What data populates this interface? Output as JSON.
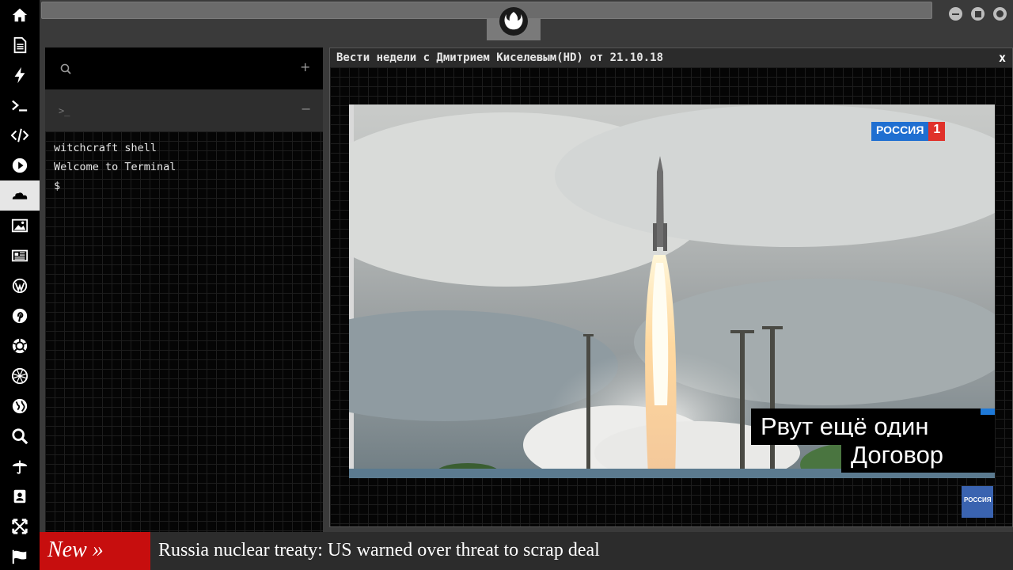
{
  "sidebar": {
    "items": [
      {
        "icon": "home-icon"
      },
      {
        "icon": "document-icon"
      },
      {
        "icon": "lightning-icon"
      },
      {
        "icon": "terminal-icon"
      },
      {
        "icon": "code-icon"
      },
      {
        "icon": "play-icon"
      },
      {
        "icon": "cloud-icon",
        "active": true
      },
      {
        "icon": "image-icon"
      },
      {
        "icon": "newspaper-icon"
      },
      {
        "icon": "wordpress-icon"
      },
      {
        "icon": "pinterest-icon"
      },
      {
        "icon": "aperture-icon"
      },
      {
        "icon": "globe-wire-icon"
      },
      {
        "icon": "globe-icon"
      },
      {
        "icon": "search-icon"
      },
      {
        "icon": "umbrella-icon"
      },
      {
        "icon": "contact-icon"
      },
      {
        "icon": "expand-icon"
      },
      {
        "icon": "flag-icon"
      }
    ]
  },
  "topbar": {
    "logo_icon": "rebel-alliance-icon",
    "window_buttons": [
      "minimize-icon",
      "maximize-icon",
      "close-icon"
    ]
  },
  "terminal": {
    "search_icon": "search-icon",
    "add_label": "+",
    "tab_prompt": ">_",
    "tab_close_label": "−",
    "lines": [
      "witchcraft shell",
      "Welcome to Terminal",
      "$"
    ]
  },
  "video": {
    "title": "Вести недели с Дмитрием Киселевым(HD) от 21.10.18",
    "close_label": "x",
    "channel_badge_text": "РОССИЯ",
    "channel_badge_number": "1",
    "caption_line1": "Рвут ещё один",
    "caption_line2": "Договор",
    "corner_logo_text": "РОССИЯ"
  },
  "ticker": {
    "badge": "New »",
    "headline": "Russia nuclear treaty: US warned over threat to scrap deal"
  },
  "colors": {
    "sidebar_bg": "#000000",
    "active_item_bg": "#e6e6e6",
    "ticker_badge": "#c70e0e",
    "channel_blue": "#1f6fd1",
    "channel_red": "#e0312a"
  }
}
